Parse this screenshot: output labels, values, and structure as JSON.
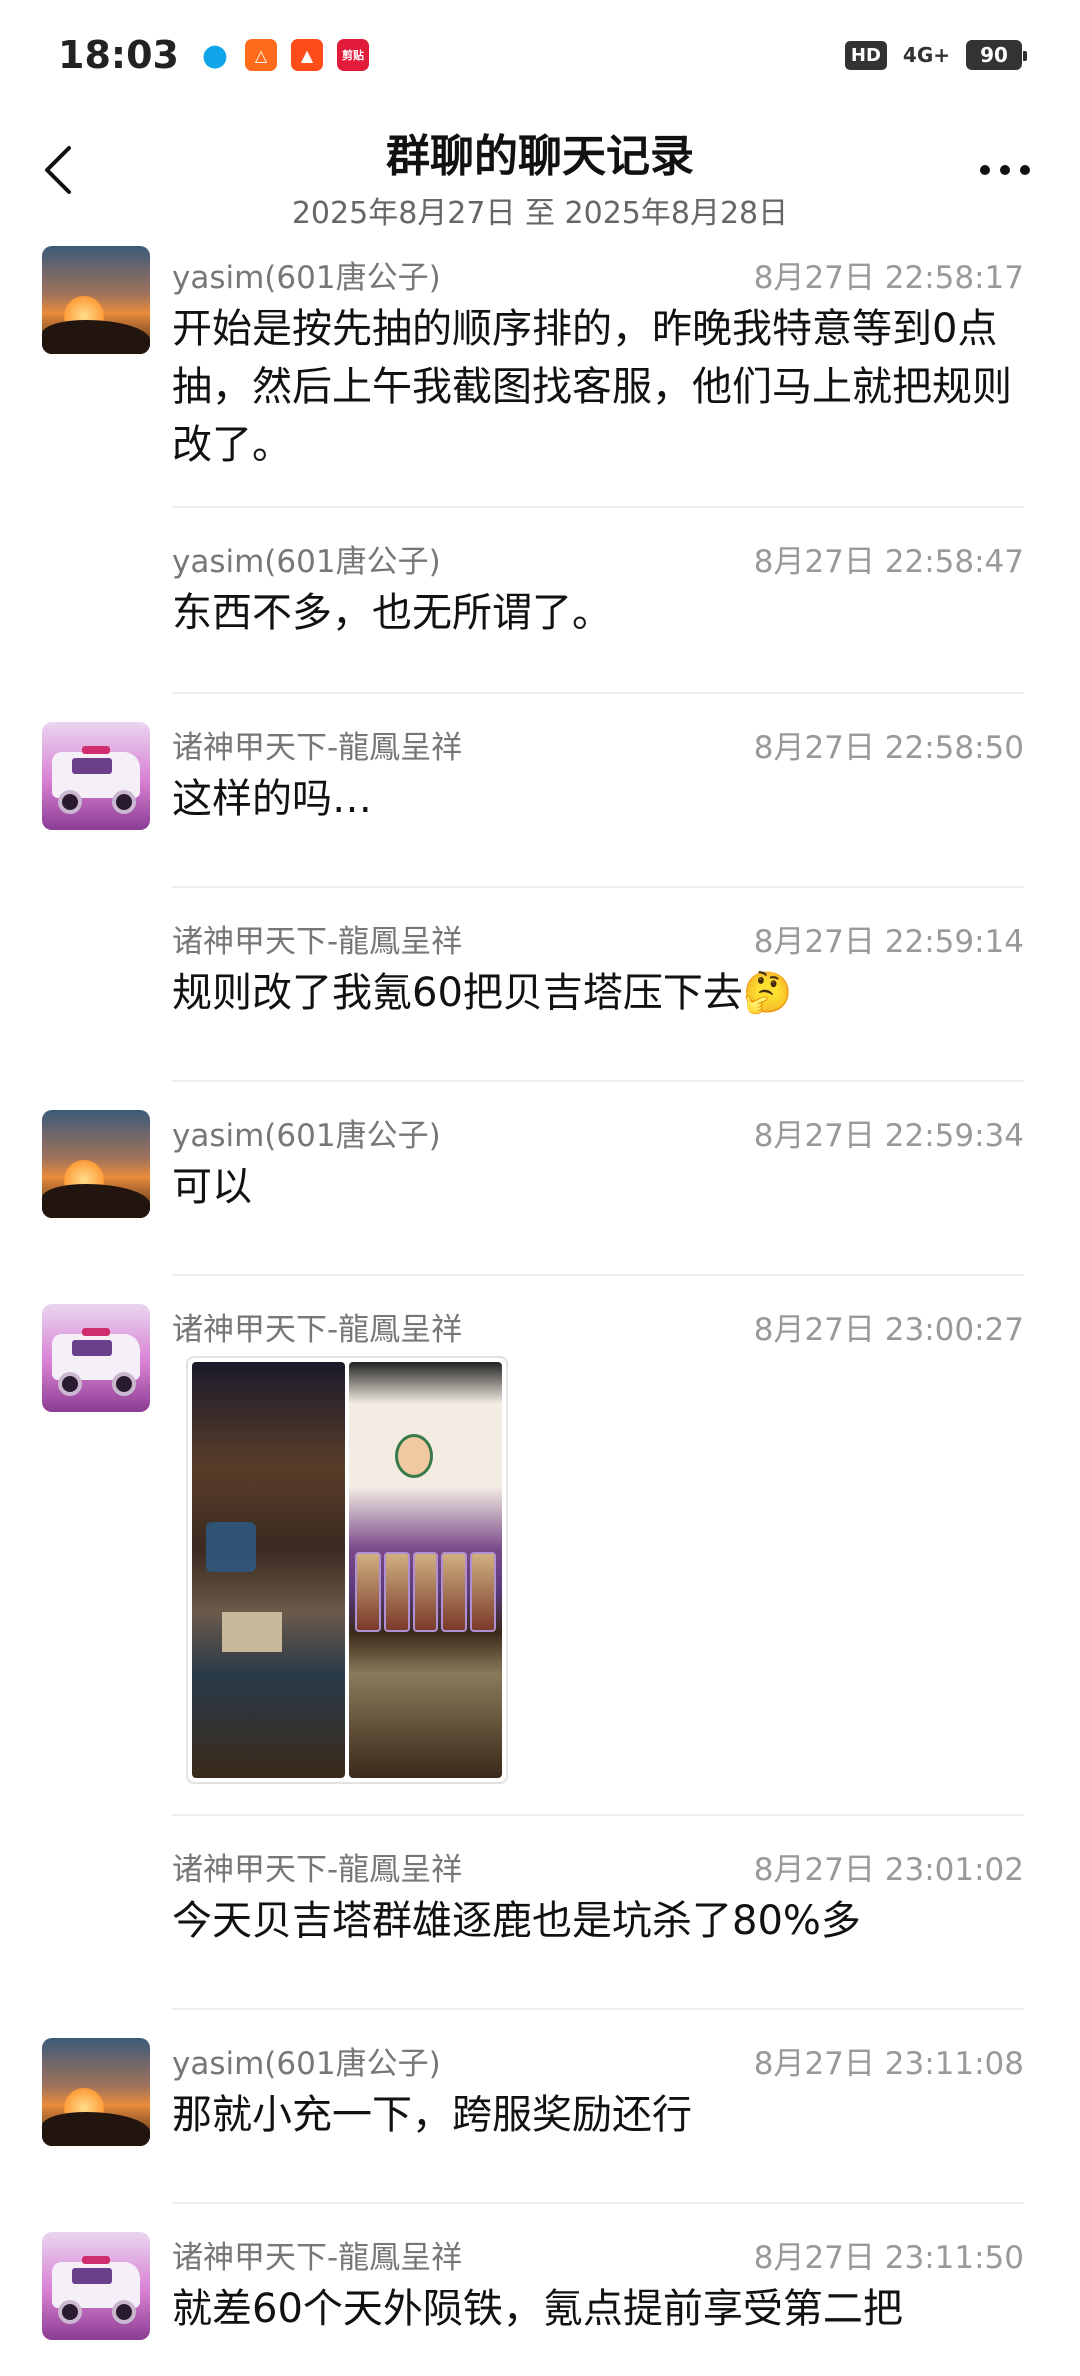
{
  "status_bar": {
    "time": "18:03",
    "notifications": [
      "qq-icon",
      "app-icon-orange",
      "app-icon-orange-2",
      "app-icon-red"
    ],
    "notif_c_label": "剪贴",
    "hd": "HD",
    "network": "4G+",
    "battery": "90"
  },
  "header": {
    "title": "群聊的聊天记录",
    "date_range": "2025年8月27日 至 2025年8月28日"
  },
  "messages": [
    {
      "sender": "yasim(601唐公子)",
      "time": "8月27日 22:58:17",
      "text": "开始是按先抽的顺序排的，昨晚我特意等到0点抽，然后上午我截图找客服，他们马上就把规则改了。",
      "avatar": "sunset"
    },
    {
      "sender": "yasim(601唐公子)",
      "time": "8月27日 22:58:47",
      "text": "东西不多，也无所谓了。",
      "avatar": ""
    },
    {
      "sender": "诸神甲天下-龍鳳呈祥",
      "time": "8月27日 22:58:50",
      "text": "这样的吗…",
      "avatar": "car"
    },
    {
      "sender": "诸神甲天下-龍鳳呈祥",
      "time": "8月27日 22:59:14",
      "text": "规则改了我氪60把贝吉塔压下去🤔",
      "avatar": ""
    },
    {
      "sender": "yasim(601唐公子)",
      "time": "8月27日 22:59:34",
      "text": "可以",
      "avatar": "sunset"
    },
    {
      "sender": "诸神甲天下-龍鳳呈祥",
      "time": "8月27日 23:00:27",
      "text": "",
      "avatar": "car"
    },
    {
      "sender": "诸神甲天下-龍鳳呈祥",
      "time": "8月27日 23:01:02",
      "text": "今天贝吉塔群雄逐鹿也是坑杀了80%多",
      "avatar": ""
    },
    {
      "sender": "yasim(601唐公子)",
      "time": "8月27日 23:11:08",
      "text": "那就小充一下，跨服奖励还行",
      "avatar": "sunset"
    },
    {
      "sender": "诸神甲天下-龍鳳呈祥",
      "time": "8月27日 23:11:50",
      "text": "就差60个天外陨铁，氪点提前享受第二把",
      "avatar": "car"
    }
  ]
}
